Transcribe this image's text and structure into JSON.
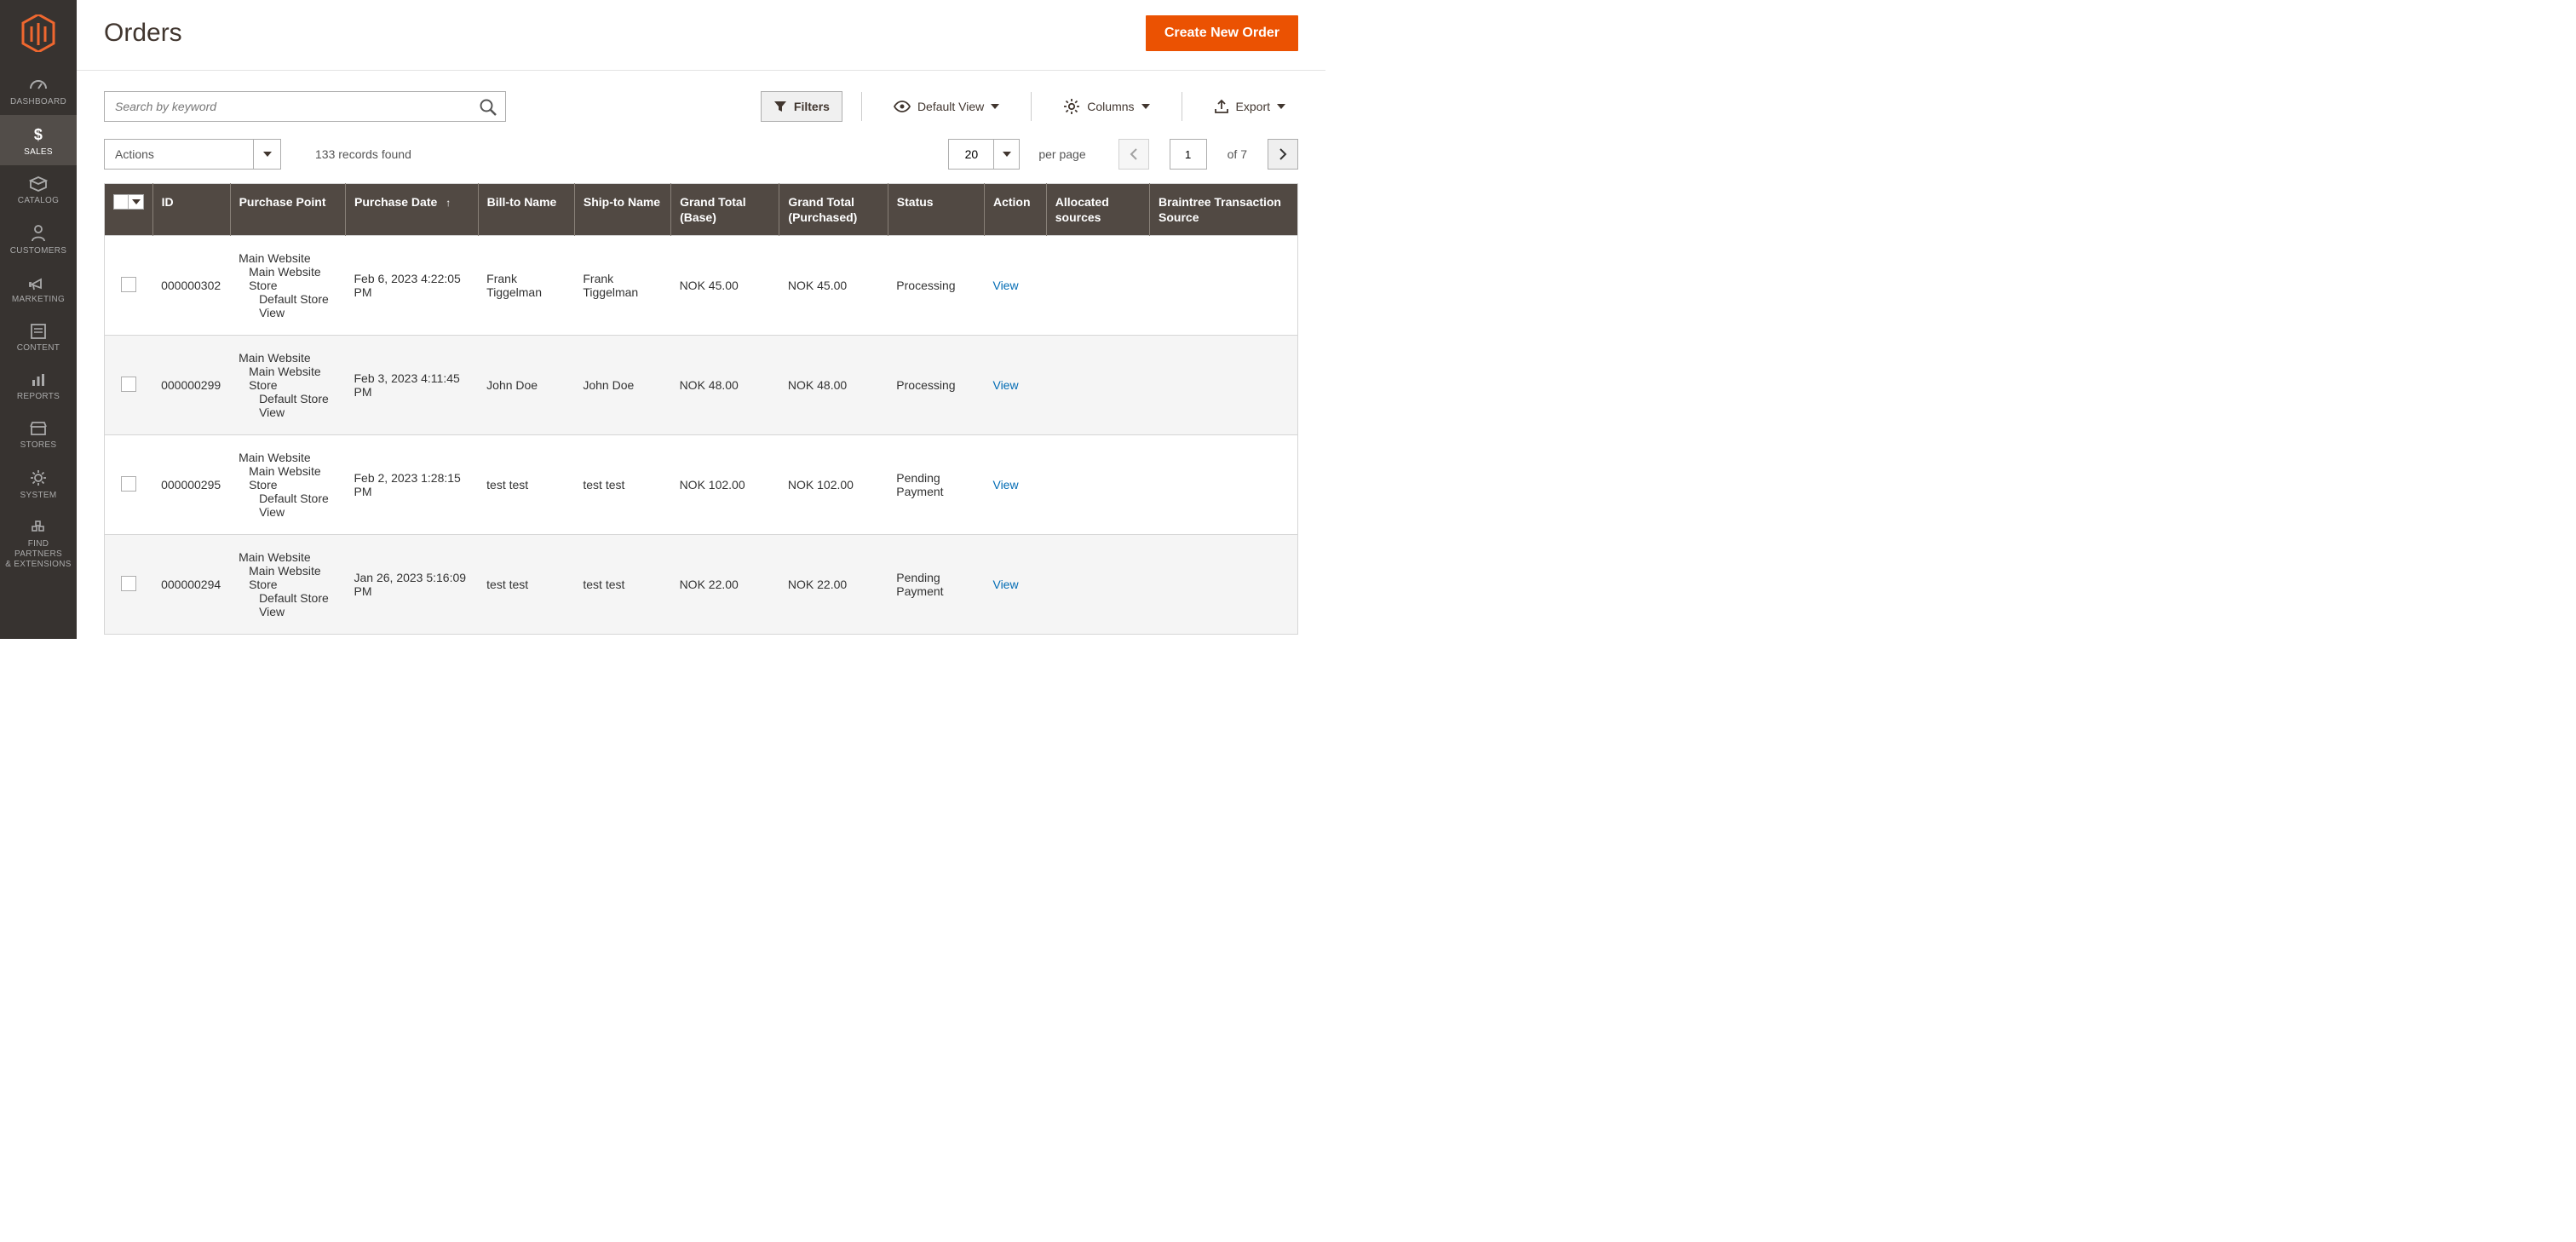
{
  "sidebar": {
    "items": [
      {
        "label": "DASHBOARD",
        "icon": "dashboard"
      },
      {
        "label": "SALES",
        "icon": "sales"
      },
      {
        "label": "CATALOG",
        "icon": "catalog"
      },
      {
        "label": "CUSTOMERS",
        "icon": "customers"
      },
      {
        "label": "MARKETING",
        "icon": "marketing"
      },
      {
        "label": "CONTENT",
        "icon": "content"
      },
      {
        "label": "REPORTS",
        "icon": "reports"
      },
      {
        "label": "STORES",
        "icon": "stores"
      },
      {
        "label": "SYSTEM",
        "icon": "system"
      },
      {
        "label": "FIND PARTNERS\n& EXTENSIONS",
        "icon": "partners"
      }
    ]
  },
  "header": {
    "title": "Orders",
    "create_order": "Create New Order"
  },
  "toolbar": {
    "search_placeholder": "Search by keyword",
    "filters": "Filters",
    "default_view": "Default View",
    "columns": "Columns",
    "export": "Export",
    "actions": "Actions",
    "records_found": "133 records found",
    "page_size": "20",
    "per_page": "per page",
    "page_current": "1",
    "page_total": "of 7"
  },
  "grid": {
    "columns": [
      "ID",
      "Purchase Point",
      "Purchase Date",
      "Bill-to Name",
      "Ship-to Name",
      "Grand Total (Base)",
      "Grand Total (Purchased)",
      "Status",
      "Action",
      "Allocated sources",
      "Braintree Transaction Source"
    ],
    "view_label": "View",
    "purchase_point": {
      "l1": "Main Website",
      "l2": "Main Website Store",
      "l3": "Default Store View"
    },
    "rows": [
      {
        "id": "000000302",
        "date": "Feb 6, 2023 4:22:05 PM",
        "bill": "Frank Tiggelman",
        "ship": "Frank Tiggelman",
        "gt_base": "NOK 45.00",
        "gt_purch": "NOK 45.00",
        "status": "Processing"
      },
      {
        "id": "000000299",
        "date": "Feb 3, 2023 4:11:45 PM",
        "bill": "John Doe",
        "ship": "John Doe",
        "gt_base": "NOK 48.00",
        "gt_purch": "NOK 48.00",
        "status": "Processing"
      },
      {
        "id": "000000295",
        "date": "Feb 2, 2023 1:28:15 PM",
        "bill": "test test",
        "ship": "test test",
        "gt_base": "NOK 102.00",
        "gt_purch": "NOK 102.00",
        "status": "Pending Payment"
      },
      {
        "id": "000000294",
        "date": "Jan 26, 2023 5:16:09 PM",
        "bill": "test test",
        "ship": "test test",
        "gt_base": "NOK 22.00",
        "gt_purch": "NOK 22.00",
        "status": "Pending Payment"
      }
    ]
  }
}
